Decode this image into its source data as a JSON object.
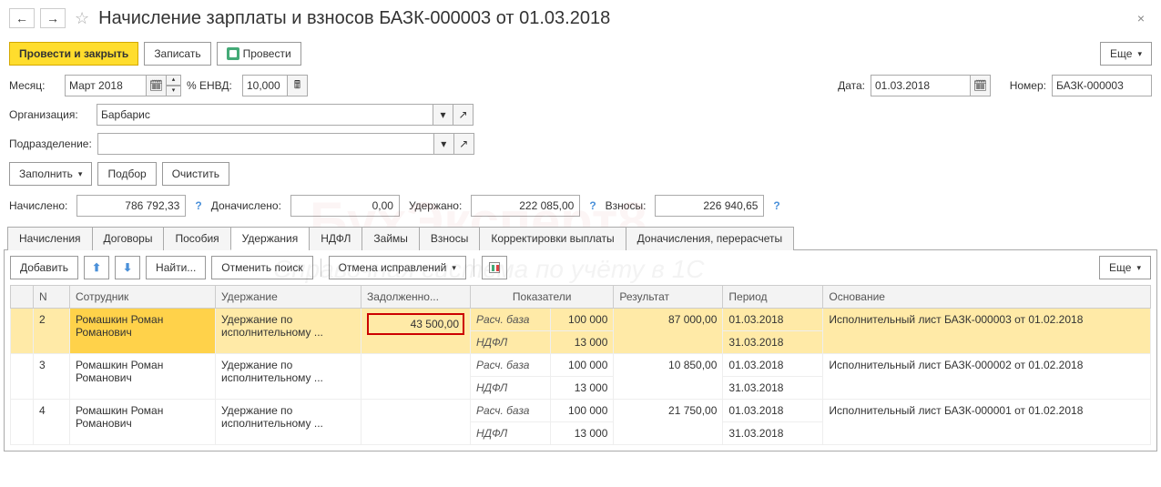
{
  "titleBar": {
    "title": "Начисление зарплаты и взносов БАЗК-000003 от 01.03.2018"
  },
  "commandBar": {
    "postClose": "Провести и закрыть",
    "write": "Записать",
    "post": "Провести",
    "more": "Еще"
  },
  "form": {
    "monthLabel": "Месяц:",
    "monthValue": "Март 2018",
    "envdLabel": "% ЕНВД:",
    "envdValue": "10,000",
    "dateLabel": "Дата:",
    "dateValue": "01.03.2018",
    "numberLabel": "Номер:",
    "numberValue": "БАЗК-000003",
    "orgLabel": "Организация:",
    "orgValue": "Барбарис",
    "divLabel": "Подразделение:",
    "divValue": ""
  },
  "rowButtons": {
    "fill": "Заполнить",
    "select": "Подбор",
    "clear": "Очистить"
  },
  "totals": {
    "accruedLabel": "Начислено:",
    "accruedValue": "786 792,33",
    "additionalLabel": "Доначислено:",
    "additionalValue": "0,00",
    "withheldLabel": "Удержано:",
    "withheldValue": "222 085,00",
    "contribLabel": "Взносы:",
    "contribValue": "226 940,65"
  },
  "tabs": {
    "t0": "Начисления",
    "t1": "Договоры",
    "t2": "Пособия",
    "t3": "Удержания",
    "t4": "НДФЛ",
    "t5": "Займы",
    "t6": "Взносы",
    "t7": "Корректировки выплаты",
    "t8": "Доначисления, перерасчеты"
  },
  "panelToolbar": {
    "add": "Добавить",
    "find": "Найти...",
    "cancelSearch": "Отменить поиск",
    "cancelCorr": "Отмена исправлений",
    "more": "Еще"
  },
  "gridHeaders": {
    "num": "N",
    "emp": "Сотрудник",
    "ded": "Удержание",
    "debt": "Задолженно...",
    "ind": "Показатели",
    "res": "Результат",
    "per": "Период",
    "base": "Основание"
  },
  "indicators": {
    "base": "Расч. база",
    "ndfl": "НДФЛ"
  },
  "rows": [
    {
      "n": "2",
      "emp": "Ромашкин Роман Романович",
      "ded": "Удержание по исполнительному ...",
      "debt": "43 500,00",
      "baseVal": "100 000",
      "ndflVal": "13 000",
      "res": "87 000,00",
      "perFrom": "01.03.2018",
      "perTo": "31.03.2018",
      "basis": "Исполнительный лист БАЗК-000003 от 01.02.2018"
    },
    {
      "n": "3",
      "emp": "Ромашкин Роман Романович",
      "ded": "Удержание по исполнительному ...",
      "debt": "",
      "baseVal": "100 000",
      "ndflVal": "13 000",
      "res": "10 850,00",
      "perFrom": "01.03.2018",
      "perTo": "31.03.2018",
      "basis": "Исполнительный лист БАЗК-000002 от 01.02.2018"
    },
    {
      "n": "4",
      "emp": "Ромашкин Роман Романович",
      "ded": "Удержание по исполнительному ...",
      "debt": "",
      "baseVal": "100 000",
      "ndflVal": "13 000",
      "res": "21 750,00",
      "perFrom": "01.03.2018",
      "perTo": "31.03.2018",
      "basis": "Исполнительный лист БАЗК-000001 от 01.02.2018"
    }
  ]
}
